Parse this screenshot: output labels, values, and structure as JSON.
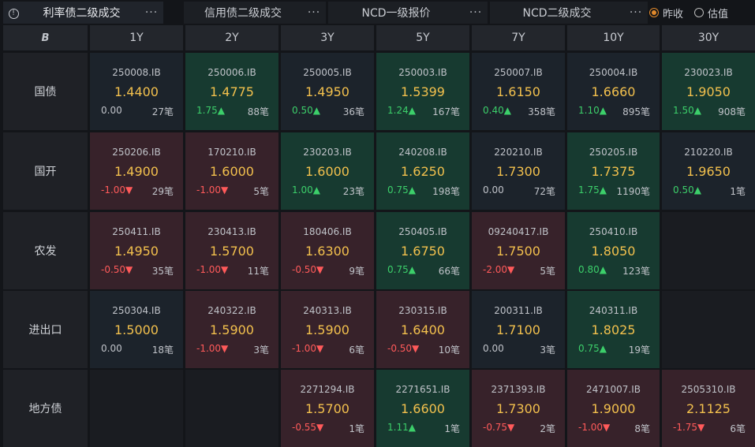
{
  "tabs": [
    {
      "label": "利率债二级成交",
      "active": true
    },
    {
      "label": "信用债二级成交",
      "active": false
    },
    {
      "label": "NCD一级报价",
      "active": false
    },
    {
      "label": "NCD二级成交",
      "active": false
    }
  ],
  "more_glyph": "···",
  "info_glyph": "!",
  "radios": [
    {
      "label": "昨收",
      "checked": true
    },
    {
      "label": "估值",
      "checked": false
    }
  ],
  "corner_logo": "B",
  "tenors": [
    "1Y",
    "2Y",
    "3Y",
    "5Y",
    "7Y",
    "10Y",
    "30Y"
  ],
  "rows": [
    {
      "label": "国债",
      "cells": [
        {
          "code": "250008.IB",
          "yield": "1.4400",
          "chg": "0.00",
          "dir": "flat",
          "count": "27笔",
          "tone": "neutral"
        },
        {
          "code": "250006.IB",
          "yield": "1.4775",
          "chg": "1.75▲",
          "dir": "up",
          "count": "88笔",
          "tone": "green"
        },
        {
          "code": "250005.IB",
          "yield": "1.4950",
          "chg": "0.50▲",
          "dir": "up",
          "count": "36笔",
          "tone": "neutral"
        },
        {
          "code": "250003.IB",
          "yield": "1.5399",
          "chg": "1.24▲",
          "dir": "up",
          "count": "167笔",
          "tone": "green"
        },
        {
          "code": "250007.IB",
          "yield": "1.6150",
          "chg": "0.40▲",
          "dir": "up",
          "count": "358笔",
          "tone": "neutral"
        },
        {
          "code": "250004.IB",
          "yield": "1.6660",
          "chg": "1.10▲",
          "dir": "up",
          "count": "895笔",
          "tone": "neutral"
        },
        {
          "code": "230023.IB",
          "yield": "1.9050",
          "chg": "1.50▲",
          "dir": "up",
          "count": "908笔",
          "tone": "green"
        }
      ]
    },
    {
      "label": "国开",
      "cells": [
        {
          "code": "250206.IB",
          "yield": "1.4900",
          "chg": "-1.00▼",
          "dir": "down",
          "count": "29笔",
          "tone": "red"
        },
        {
          "code": "170210.IB",
          "yield": "1.6000",
          "chg": "-1.00▼",
          "dir": "down",
          "count": "5笔",
          "tone": "red"
        },
        {
          "code": "230203.IB",
          "yield": "1.6000",
          "chg": "1.00▲",
          "dir": "up",
          "count": "23笔",
          "tone": "green"
        },
        {
          "code": "240208.IB",
          "yield": "1.6250",
          "chg": "0.75▲",
          "dir": "up",
          "count": "198笔",
          "tone": "green"
        },
        {
          "code": "220210.IB",
          "yield": "1.7300",
          "chg": "0.00",
          "dir": "flat",
          "count": "72笔",
          "tone": "neutral"
        },
        {
          "code": "250205.IB",
          "yield": "1.7375",
          "chg": "1.75▲",
          "dir": "up",
          "count": "1190笔",
          "tone": "green"
        },
        {
          "code": "210220.IB",
          "yield": "1.9650",
          "chg": "0.50▲",
          "dir": "up",
          "count": "1笔",
          "tone": "neutral"
        }
      ]
    },
    {
      "label": "农发",
      "cells": [
        {
          "code": "250411.IB",
          "yield": "1.4950",
          "chg": "-0.50▼",
          "dir": "down",
          "count": "35笔",
          "tone": "red"
        },
        {
          "code": "230413.IB",
          "yield": "1.5700",
          "chg": "-1.00▼",
          "dir": "down",
          "count": "11笔",
          "tone": "red"
        },
        {
          "code": "180406.IB",
          "yield": "1.6300",
          "chg": "-0.50▼",
          "dir": "down",
          "count": "9笔",
          "tone": "red"
        },
        {
          "code": "250405.IB",
          "yield": "1.6750",
          "chg": "0.75▲",
          "dir": "up",
          "count": "66笔",
          "tone": "green"
        },
        {
          "code": "09240417.IB",
          "yield": "1.7500",
          "chg": "-2.00▼",
          "dir": "down",
          "count": "5笔",
          "tone": "red"
        },
        {
          "code": "250410.IB",
          "yield": "1.8050",
          "chg": "0.80▲",
          "dir": "up",
          "count": "123笔",
          "tone": "green"
        },
        null
      ]
    },
    {
      "label": "进出口",
      "cells": [
        {
          "code": "250304.IB",
          "yield": "1.5000",
          "chg": "0.00",
          "dir": "flat",
          "count": "18笔",
          "tone": "neutral"
        },
        {
          "code": "240322.IB",
          "yield": "1.5900",
          "chg": "-1.00▼",
          "dir": "down",
          "count": "3笔",
          "tone": "red"
        },
        {
          "code": "240313.IB",
          "yield": "1.5900",
          "chg": "-1.00▼",
          "dir": "down",
          "count": "6笔",
          "tone": "red"
        },
        {
          "code": "230315.IB",
          "yield": "1.6400",
          "chg": "-0.50▼",
          "dir": "down",
          "count": "10笔",
          "tone": "red"
        },
        {
          "code": "200311.IB",
          "yield": "1.7100",
          "chg": "0.00",
          "dir": "flat",
          "count": "3笔",
          "tone": "neutral"
        },
        {
          "code": "240311.IB",
          "yield": "1.8025",
          "chg": "0.75▲",
          "dir": "up",
          "count": "19笔",
          "tone": "green"
        },
        null
      ]
    },
    {
      "label": "地方债",
      "cells": [
        null,
        null,
        {
          "code": "2271294.IB",
          "yield": "1.5700",
          "chg": "-0.55▼",
          "dir": "down",
          "count": "1笔",
          "tone": "red"
        },
        {
          "code": "2271651.IB",
          "yield": "1.6600",
          "chg": "1.11▲",
          "dir": "up",
          "count": "1笔",
          "tone": "green"
        },
        {
          "code": "2371393.IB",
          "yield": "1.7300",
          "chg": "-0.75▼",
          "dir": "down",
          "count": "2笔",
          "tone": "red"
        },
        {
          "code": "2471007.IB",
          "yield": "1.9000",
          "chg": "-1.00▼",
          "dir": "down",
          "count": "8笔",
          "tone": "red"
        },
        {
          "code": "2505310.IB",
          "yield": "2.1125",
          "chg": "-1.75▼",
          "dir": "down",
          "count": "6笔",
          "tone": "red"
        }
      ]
    }
  ]
}
